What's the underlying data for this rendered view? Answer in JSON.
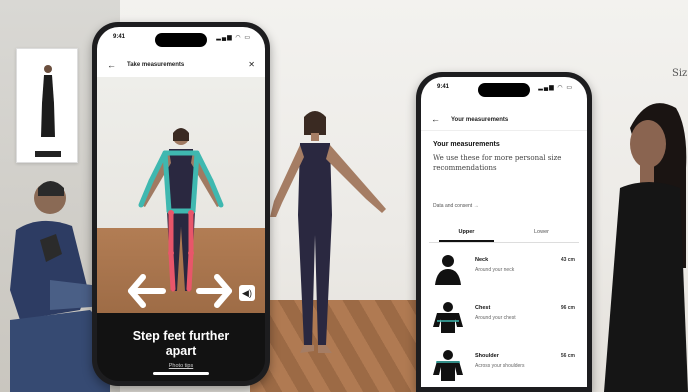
{
  "background": {
    "poster_text": "Siz"
  },
  "phone_left": {
    "status_time": "9:41",
    "status_icons": "▂▄▆ ◠ ▭",
    "nav": {
      "back_icon": "arrow-left",
      "title": "Take measurements",
      "close_icon": "close"
    },
    "instruction_line1": "Step feet further",
    "instruction_line2": "apart",
    "link": "Photo tips",
    "sound_icon": "speaker"
  },
  "phone_right": {
    "status_time": "9:41",
    "status_icons": "▂▄▆ ◠ ▭",
    "nav": {
      "back_icon": "arrow-left",
      "title": "Your measurements"
    },
    "heading": "Your measurements",
    "description": "We use these for more personal size recommendations",
    "consent_link": "Data and consent →",
    "tabs": [
      {
        "label": "Upper",
        "active": true
      },
      {
        "label": "Lower",
        "active": false
      }
    ],
    "rows": [
      {
        "label": "Neck",
        "sub": "Around your neck",
        "value": "43 cm",
        "icon": "neck-diagram"
      },
      {
        "label": "Chest",
        "sub": "Around your chest",
        "value": "96 cm",
        "icon": "chest-diagram"
      },
      {
        "label": "Shoulder",
        "sub": "Across your shoulders",
        "value": "56 cm",
        "icon": "shoulder-diagram"
      }
    ]
  },
  "colors": {
    "skeleton_upper": "#3fb8b0",
    "skeleton_lower": "#e8566a",
    "arrow": "#ffffff",
    "floor": "#a8724b",
    "bodysuit": "#2a2840"
  }
}
